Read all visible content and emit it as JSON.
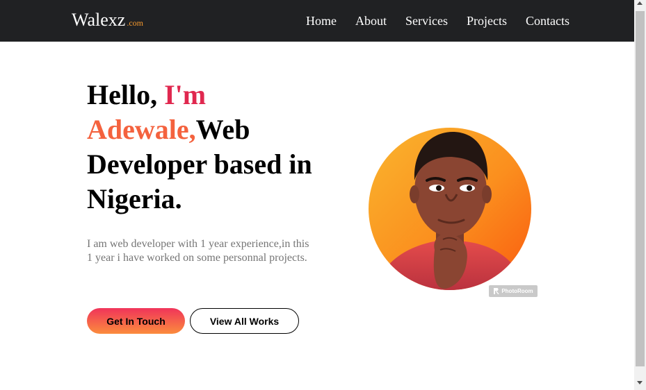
{
  "brand": {
    "name": "Walexz",
    "tld": ".com"
  },
  "nav": {
    "items": [
      "Home",
      "About",
      "Services",
      "Projects",
      "Contacts"
    ]
  },
  "hero": {
    "greeting": "Hello, ",
    "im": "I'm",
    "name": "Adewale,",
    "role_line": "Web Developer based in Nigeria.",
    "description": "I am web developer with 1 year experience,in this 1 year i have worked on some personnal projects.",
    "primary_button": "Get In Touch",
    "secondary_button": "View All Works"
  },
  "badge": {
    "text": "PhotoRoom",
    "icon": "photoroom-logo-icon"
  },
  "colors": {
    "nav_bg": "#202123",
    "accent_red": "#e0284f",
    "accent_orange": "#f4623e",
    "tld": "#f79a2e",
    "button_gradient": [
      "#f0345a",
      "#fb8c3d"
    ]
  }
}
